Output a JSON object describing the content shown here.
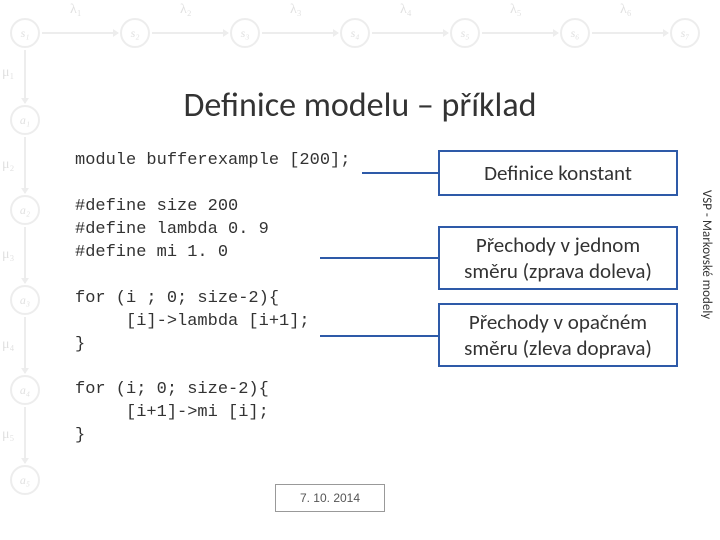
{
  "title": "Definice modelu – příklad",
  "code": {
    "l1": "module bufferexample [200];",
    "l2": "",
    "l3": "#define size 200",
    "l4": "#define lambda 0. 9",
    "l5": "#define mi 1. 0",
    "l6": "",
    "l7": "for (i ; 0; size-2){",
    "l8": "     [i]->lambda [i+1];",
    "l9": "}",
    "l10": "",
    "l11": "for (i; 0; size-2){",
    "l12": "     [i+1]->mi [i];",
    "l13": "}"
  },
  "annotations": {
    "constants": "Definice konstant",
    "forward": "Přechody v jednom směru (zprava doleva)",
    "backward": "Přechody v opačném směru (zleva doprava)"
  },
  "side_label": "VSP - Markovské modely",
  "date": "7. 10. 2014",
  "diagram": {
    "s_labels": [
      "s₁",
      "s₂",
      "s₃",
      "s₄",
      "s₅",
      "s₆",
      "s₇"
    ],
    "a_labels": [
      "a₁",
      "a₂",
      "a₃",
      "a₄",
      "a₅"
    ],
    "lambda_labels": [
      "λ₁",
      "λ₂",
      "λ₃",
      "λ₄",
      "λ₅",
      "λ₆"
    ],
    "mu_labels": [
      "μ₁",
      "μ₂",
      "μ₃",
      "μ₄",
      "μ₅"
    ]
  }
}
